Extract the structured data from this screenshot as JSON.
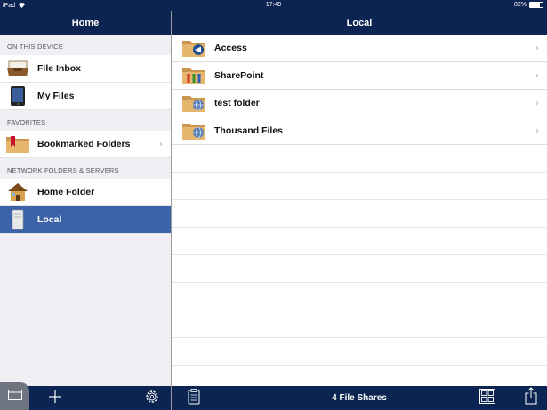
{
  "status_bar": {
    "device": "iPad",
    "time": "17:49",
    "battery": "82%",
    "battery_level": 0.82
  },
  "left": {
    "title": "Home",
    "sections": [
      {
        "header": "ON THIS DEVICE",
        "items": [
          {
            "label": "File Inbox",
            "icon": "inbox-tray-icon"
          },
          {
            "label": "My Files",
            "icon": "ipad-device-icon"
          }
        ]
      },
      {
        "header": "FAVORITES",
        "items": [
          {
            "label": "Bookmarked Folders",
            "icon": "bookmark-folder-icon",
            "chevron": true
          }
        ]
      },
      {
        "header": "NETWORK FOLDERS & SERVERS",
        "items": [
          {
            "label": "Home Folder",
            "icon": "house-icon"
          },
          {
            "label": "Local",
            "icon": "local-server-icon",
            "selected": true
          }
        ]
      }
    ],
    "toolbar": [
      "folders-tab-icon",
      "add-icon",
      "settings-gear-icon"
    ]
  },
  "right": {
    "title": "Local",
    "items": [
      {
        "label": "Access",
        "icon": "folder-access-icon"
      },
      {
        "label": "SharePoint",
        "icon": "folder-sharepoint-icon"
      },
      {
        "label": "test folder",
        "icon": "folder-globe-icon"
      },
      {
        "label": "Thousand Files",
        "icon": "folder-globe-icon"
      }
    ],
    "toolbar": {
      "status": "4 File Shares",
      "icons": [
        "clipboard-icon",
        "grid-view-icon",
        "share-icon"
      ]
    }
  },
  "colors": {
    "navbar": "#0c2451",
    "selected_row": "#3c63a8",
    "background": "#efeff4"
  }
}
